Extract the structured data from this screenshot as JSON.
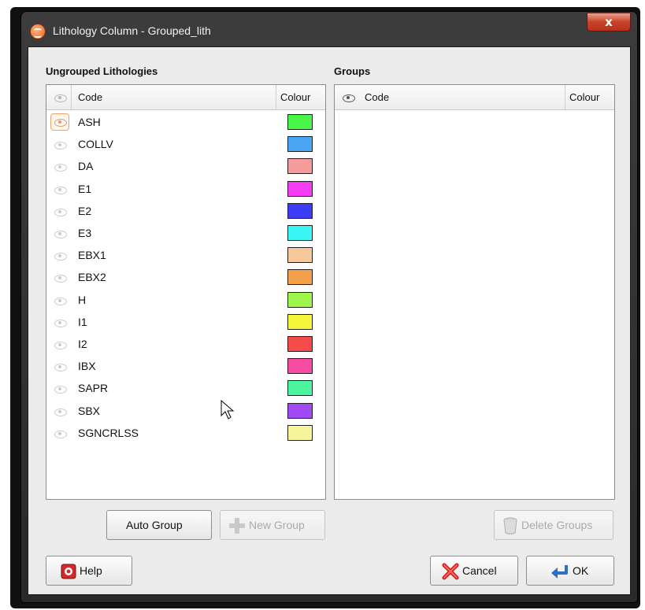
{
  "window": {
    "title": "Lithology Column - Grouped_lith",
    "close_label": "x"
  },
  "ungrouped": {
    "title": "Ungrouped Lithologies",
    "col_code": "Code",
    "col_colour": "Colour",
    "rows": [
      {
        "code": "ASH",
        "color": "#49f549"
      },
      {
        "code": "COLLV",
        "color": "#4ba5f5"
      },
      {
        "code": "DA",
        "color": "#f59b9b"
      },
      {
        "code": "E1",
        "color": "#f53cf5"
      },
      {
        "code": "E2",
        "color": "#3c3cf5"
      },
      {
        "code": "E3",
        "color": "#3cf5f5"
      },
      {
        "code": "EBX1",
        "color": "#f7c89b"
      },
      {
        "code": "EBX2",
        "color": "#f5a04b"
      },
      {
        "code": "H",
        "color": "#a0f54b"
      },
      {
        "code": "I1",
        "color": "#f5f53c"
      },
      {
        "code": "I2",
        "color": "#f54b4b"
      },
      {
        "code": "IBX",
        "color": "#f54ba0"
      },
      {
        "code": "SAPR",
        "color": "#4bf5a0"
      },
      {
        "code": "SBX",
        "color": "#a04bf5"
      },
      {
        "code": "SGNCRLSS",
        "color": "#f7f59b"
      }
    ]
  },
  "groups": {
    "title": "Groups",
    "col_code": "Code",
    "col_colour": "Colour"
  },
  "buttons": {
    "auto_group": "Auto Group",
    "new_group": "New Group",
    "delete_groups": "Delete Groups",
    "help": "Help",
    "cancel": "Cancel",
    "ok": "OK"
  },
  "icons": {
    "app": "lithology-app-icon",
    "eye": "eye-icon",
    "plus": "plus-icon",
    "trash": "trash-icon",
    "lifebuoy": "lifebuoy-icon",
    "cancel": "red-x-icon",
    "ok": "enter-arrow-icon"
  }
}
